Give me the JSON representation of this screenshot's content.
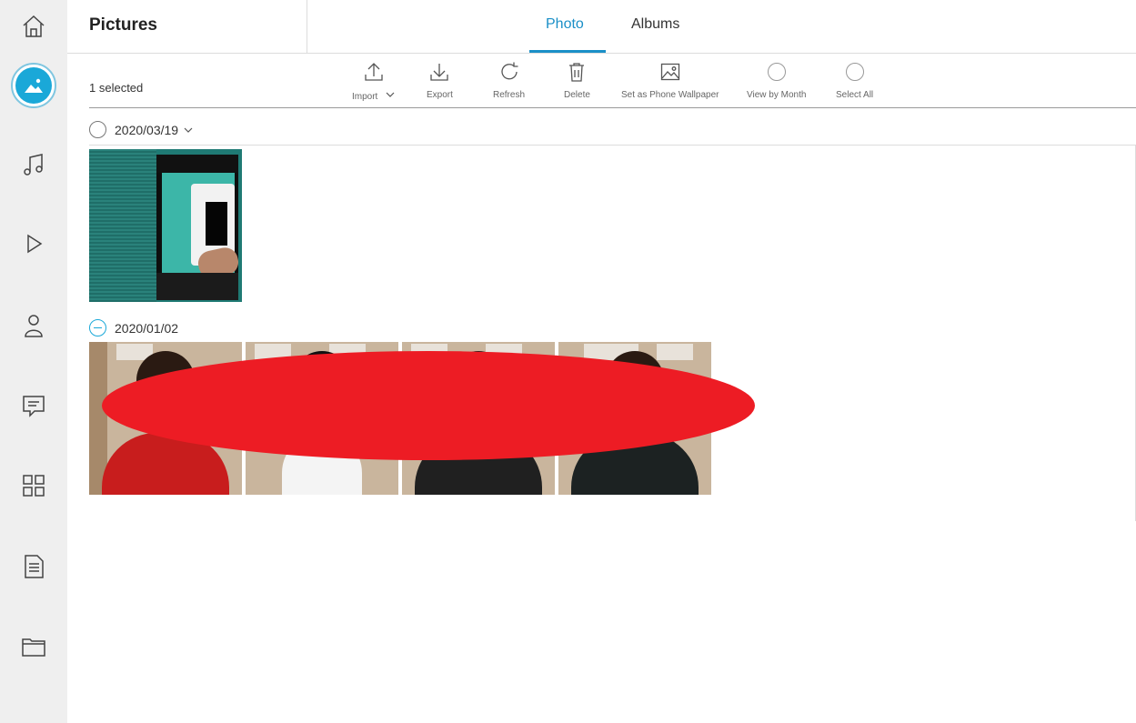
{
  "app": {
    "page_title": "Pictures",
    "tabs": [
      {
        "label": "Photo",
        "active": true
      },
      {
        "label": "Albums",
        "active": false
      }
    ],
    "accent_color": "#1a8fc7"
  },
  "sidebar": {
    "items": [
      {
        "name": "home",
        "icon": "home-icon"
      },
      {
        "name": "pictures",
        "icon": "pictures-icon",
        "active": true
      },
      {
        "name": "music",
        "icon": "music-note-icon"
      },
      {
        "name": "video",
        "icon": "play-icon"
      },
      {
        "name": "contacts",
        "icon": "person-icon"
      },
      {
        "name": "messages",
        "icon": "message-icon"
      },
      {
        "name": "apps",
        "icon": "grid-icon"
      },
      {
        "name": "documents",
        "icon": "document-icon"
      },
      {
        "name": "files",
        "icon": "folder-icon"
      }
    ]
  },
  "toolbar": {
    "selected_text": "1 selected",
    "import_label": "Import",
    "export_label": "Export",
    "refresh_label": "Refresh",
    "delete_label": "Delete",
    "wallpaper_label": "Set as Phone Wallpaper",
    "view_month_label": "View by Month",
    "select_all_label": "Select All"
  },
  "groups": [
    {
      "date": "2020/03/19",
      "photo_count": 1,
      "selection": "none",
      "collapsible": true
    },
    {
      "date": "2020/01/02",
      "photo_count": 4,
      "selection": "partial"
    }
  ],
  "redaction_color": "#ed1c24"
}
